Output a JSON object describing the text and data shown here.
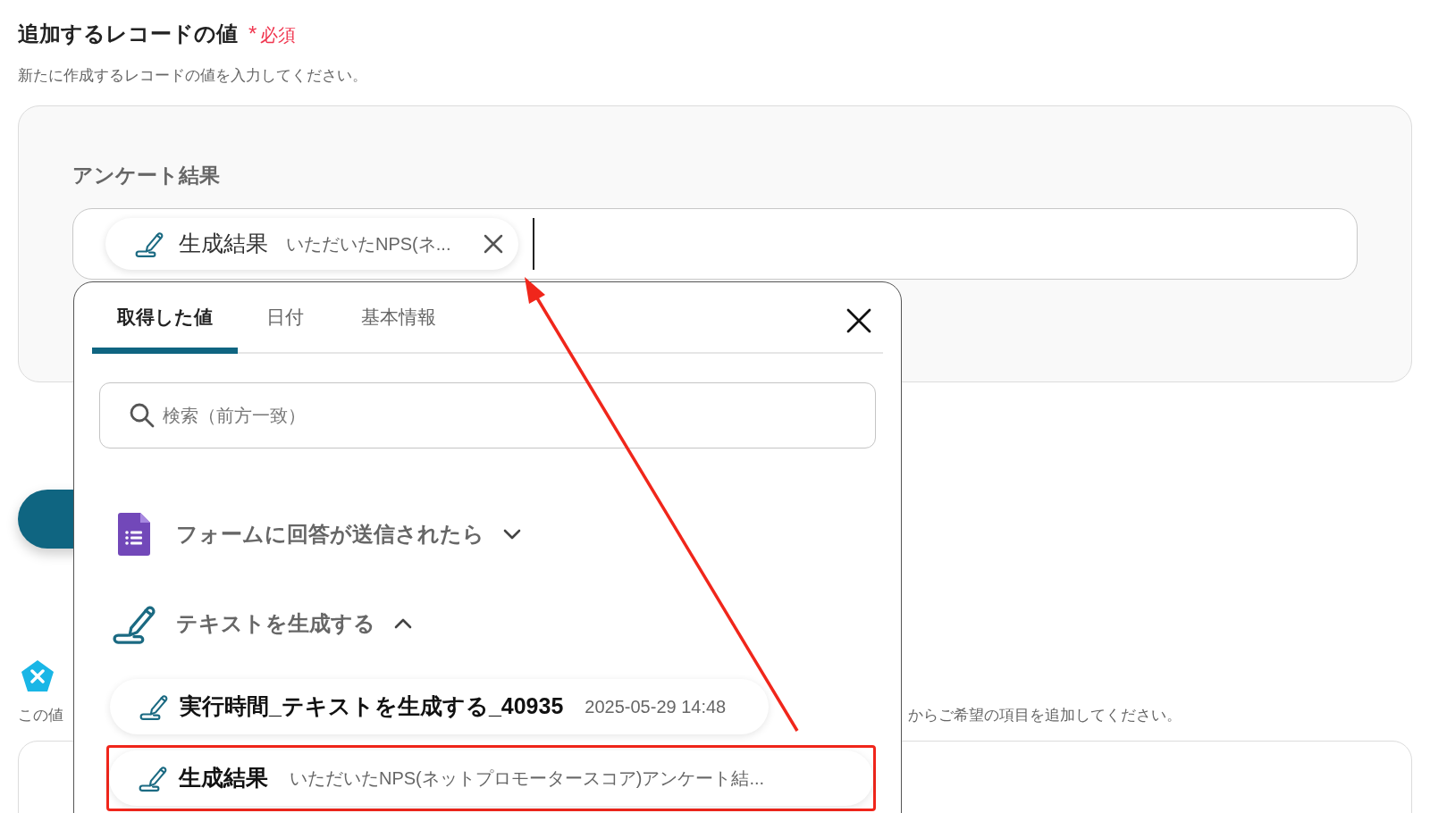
{
  "section": {
    "title": "追加するレコードの値",
    "required_mark": "*",
    "required_label": "必須",
    "description": "新たに作成するレコードの値を入力してください。"
  },
  "field": {
    "label": "アンケート結果",
    "chips": [
      {
        "name": "生成結果",
        "preview": "いただいたNPS(ネ..."
      }
    ]
  },
  "lower_section": {
    "hint_start": "この値",
    "hint_end": "からご希望の項目を追加してください。"
  },
  "popup": {
    "tabs": [
      {
        "label": "取得した値",
        "selected": true
      },
      {
        "label": "日付",
        "selected": false
      },
      {
        "label": "基本情報",
        "selected": false
      }
    ],
    "search": {
      "placeholder": "検索（前方一致）"
    },
    "groups": [
      {
        "kind": "form",
        "title": "フォームに回答が送信されたら",
        "expanded": false
      },
      {
        "kind": "ai",
        "title": "テキストを生成する",
        "expanded": true,
        "items": [
          {
            "name": "実行時間_テキストを生成する_40935",
            "value": "2025-05-29 14:48",
            "highlighted": false
          },
          {
            "name": "生成結果",
            "value": "いただいたNPS(ネットプロモータースコア)アンケート結...",
            "highlighted": true
          }
        ]
      }
    ]
  }
}
